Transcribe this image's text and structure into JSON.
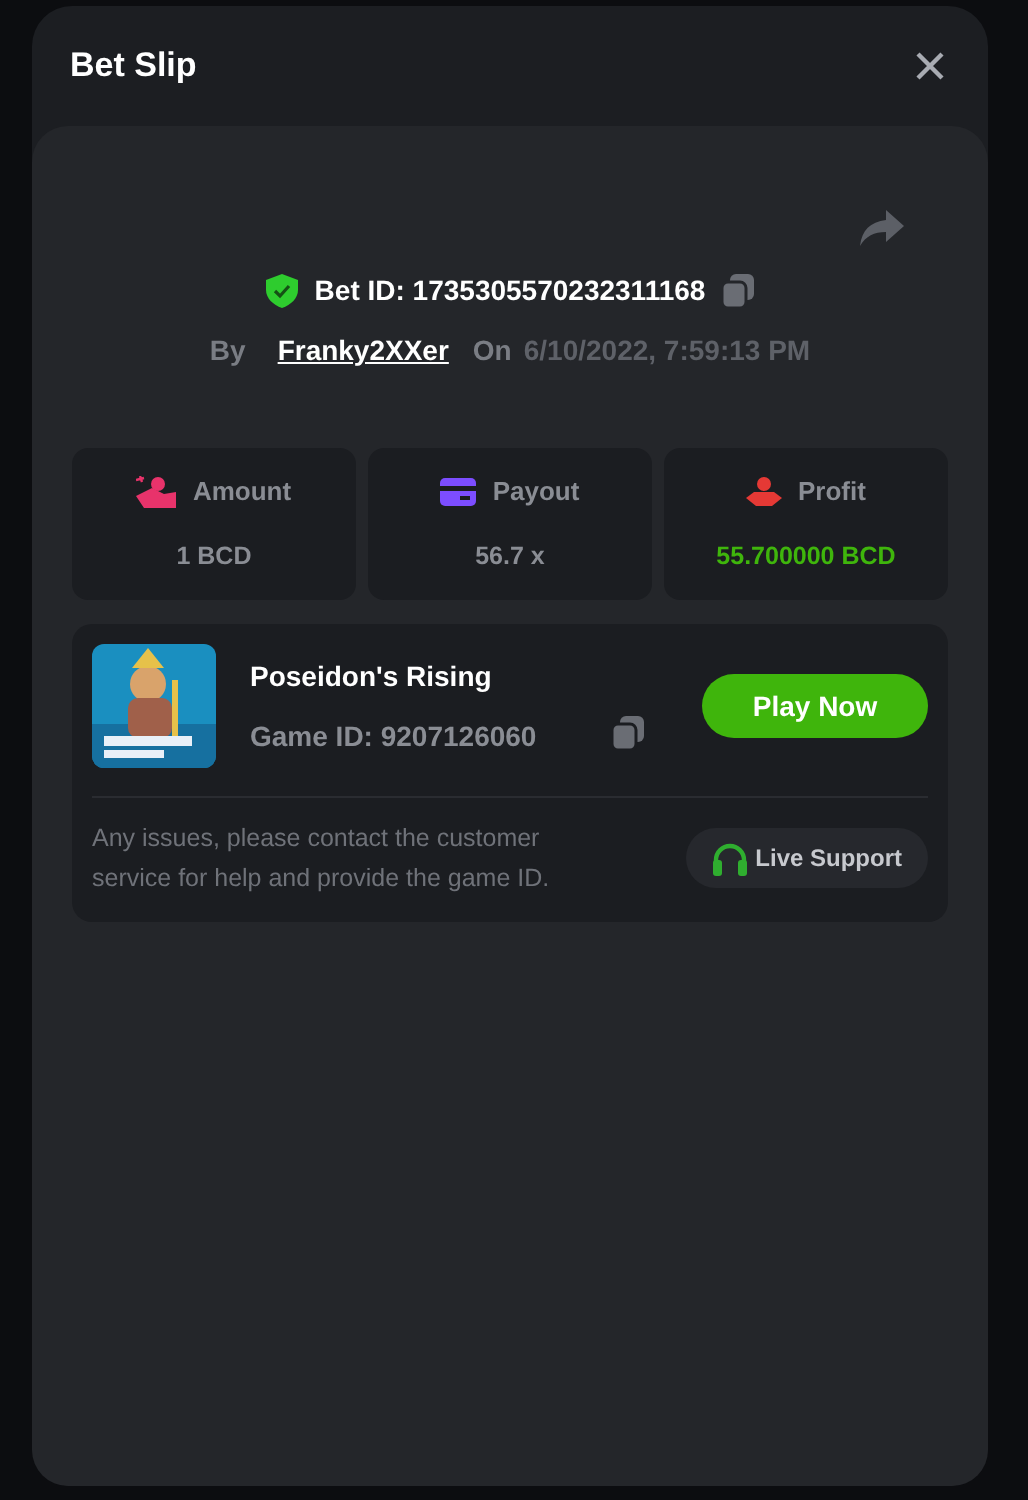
{
  "modal": {
    "title": "Bet Slip"
  },
  "bet": {
    "bet_id": "Bet ID: 1735305570232311168",
    "by_label": "By",
    "user": "Franky2XXer",
    "on_label": "On",
    "date": "6/10/2022, 7:59:13 PM"
  },
  "stats": [
    {
      "kind": "amount",
      "label": "Amount",
      "value": "1 BCD",
      "color": "#e8336b"
    },
    {
      "kind": "payout",
      "label": "Payout",
      "value": "56.7 x",
      "color": "#7c4dff"
    },
    {
      "kind": "profit",
      "label": "Profit",
      "value": "55.700000 BCD",
      "color": "#e53935"
    }
  ],
  "game": {
    "name": "Poseidon's Rising",
    "game_id": "Game ID: 9207126060",
    "play_button": "Play Now",
    "note": "Any issues, please contact the customer service for help and provide the game ID.",
    "support_button": "Live Support"
  }
}
